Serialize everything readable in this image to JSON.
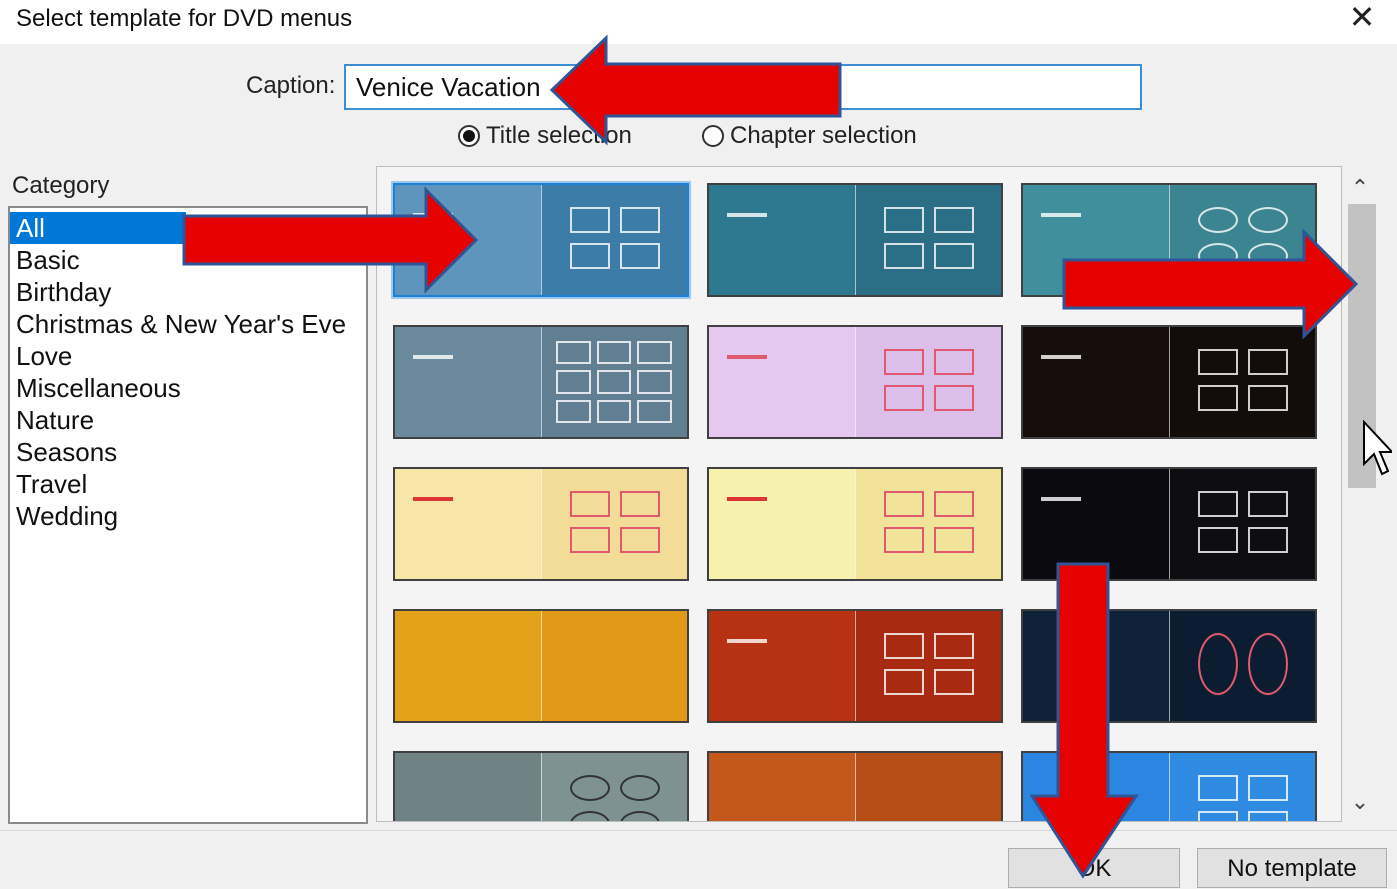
{
  "window": {
    "title": "Select template for DVD menus",
    "close_glyph": "✕"
  },
  "caption": {
    "label": "Caption:",
    "value": "Venice Vacation"
  },
  "selection_mode": {
    "options": [
      {
        "label": "Title selection",
        "selected": true
      },
      {
        "label": "Chapter selection",
        "selected": false
      }
    ]
  },
  "category": {
    "label": "Category",
    "items": [
      "All",
      "Basic",
      "Birthday",
      "Christmas & New Year's Eve",
      "Love",
      "Miscellaneous",
      "Nature",
      "Seasons",
      "Travel",
      "Wedding"
    ],
    "selected": "All"
  },
  "templates": [
    {
      "name": "blue-waves",
      "selected": true,
      "left_color": "#5e95bd",
      "right_color": "#3c7ca8"
    },
    {
      "name": "teal-lines",
      "selected": false,
      "left_color": "#2e7890",
      "right_color": "#2a6f86"
    },
    {
      "name": "teal-texture",
      "selected": false,
      "left_color": "#3f8f9c",
      "right_color": "#3a8591"
    },
    {
      "name": "slate-gray",
      "selected": false,
      "left_color": "#6b8a9e",
      "right_color": "#607f93"
    },
    {
      "name": "party-balloons",
      "selected": false,
      "left_color": "#e4c8f0",
      "right_color": "#dcbfe9"
    },
    {
      "name": "birthday-cake",
      "selected": false,
      "left_color": "#150e0c",
      "right_color": "#120c0a"
    },
    {
      "name": "christmas-tree-red",
      "selected": false,
      "left_color": "#f6e6a8",
      "right_color": "#f3dc98"
    },
    {
      "name": "christmas-tree-yellow",
      "selected": false,
      "left_color": "#f7f1b0",
      "right_color": "#f1e49a"
    },
    {
      "name": "fireworks",
      "selected": false,
      "left_color": "#0b0b0f",
      "right_color": "#0e0d12"
    },
    {
      "name": "glitter-heart",
      "selected": false,
      "left_color": "#e2a31a",
      "right_color": "#e19a18"
    },
    {
      "name": "red-hearts",
      "selected": false,
      "left_color": "#b73212",
      "right_color": "#a82a10"
    },
    {
      "name": "dark-swirls",
      "selected": false,
      "left_color": "#0e2136",
      "right_color": "#0c1d31"
    },
    {
      "name": "gray-frames",
      "selected": false,
      "left_color": "#6f8384",
      "right_color": "#7f9292"
    },
    {
      "name": "sunset-clouds",
      "selected": false,
      "left_color": "#c4581c",
      "right_color": "#b74d16"
    },
    {
      "name": "blue-grass",
      "selected": false,
      "left_color": "#2a86e0",
      "right_color": "#2f8be2"
    }
  ],
  "buttons": {
    "ok": "OK",
    "no_template": "No template"
  },
  "colors": {
    "accent": "#0078d7",
    "annotation_arrow": "#e60000",
    "arrow_outline": "#2f5597"
  }
}
